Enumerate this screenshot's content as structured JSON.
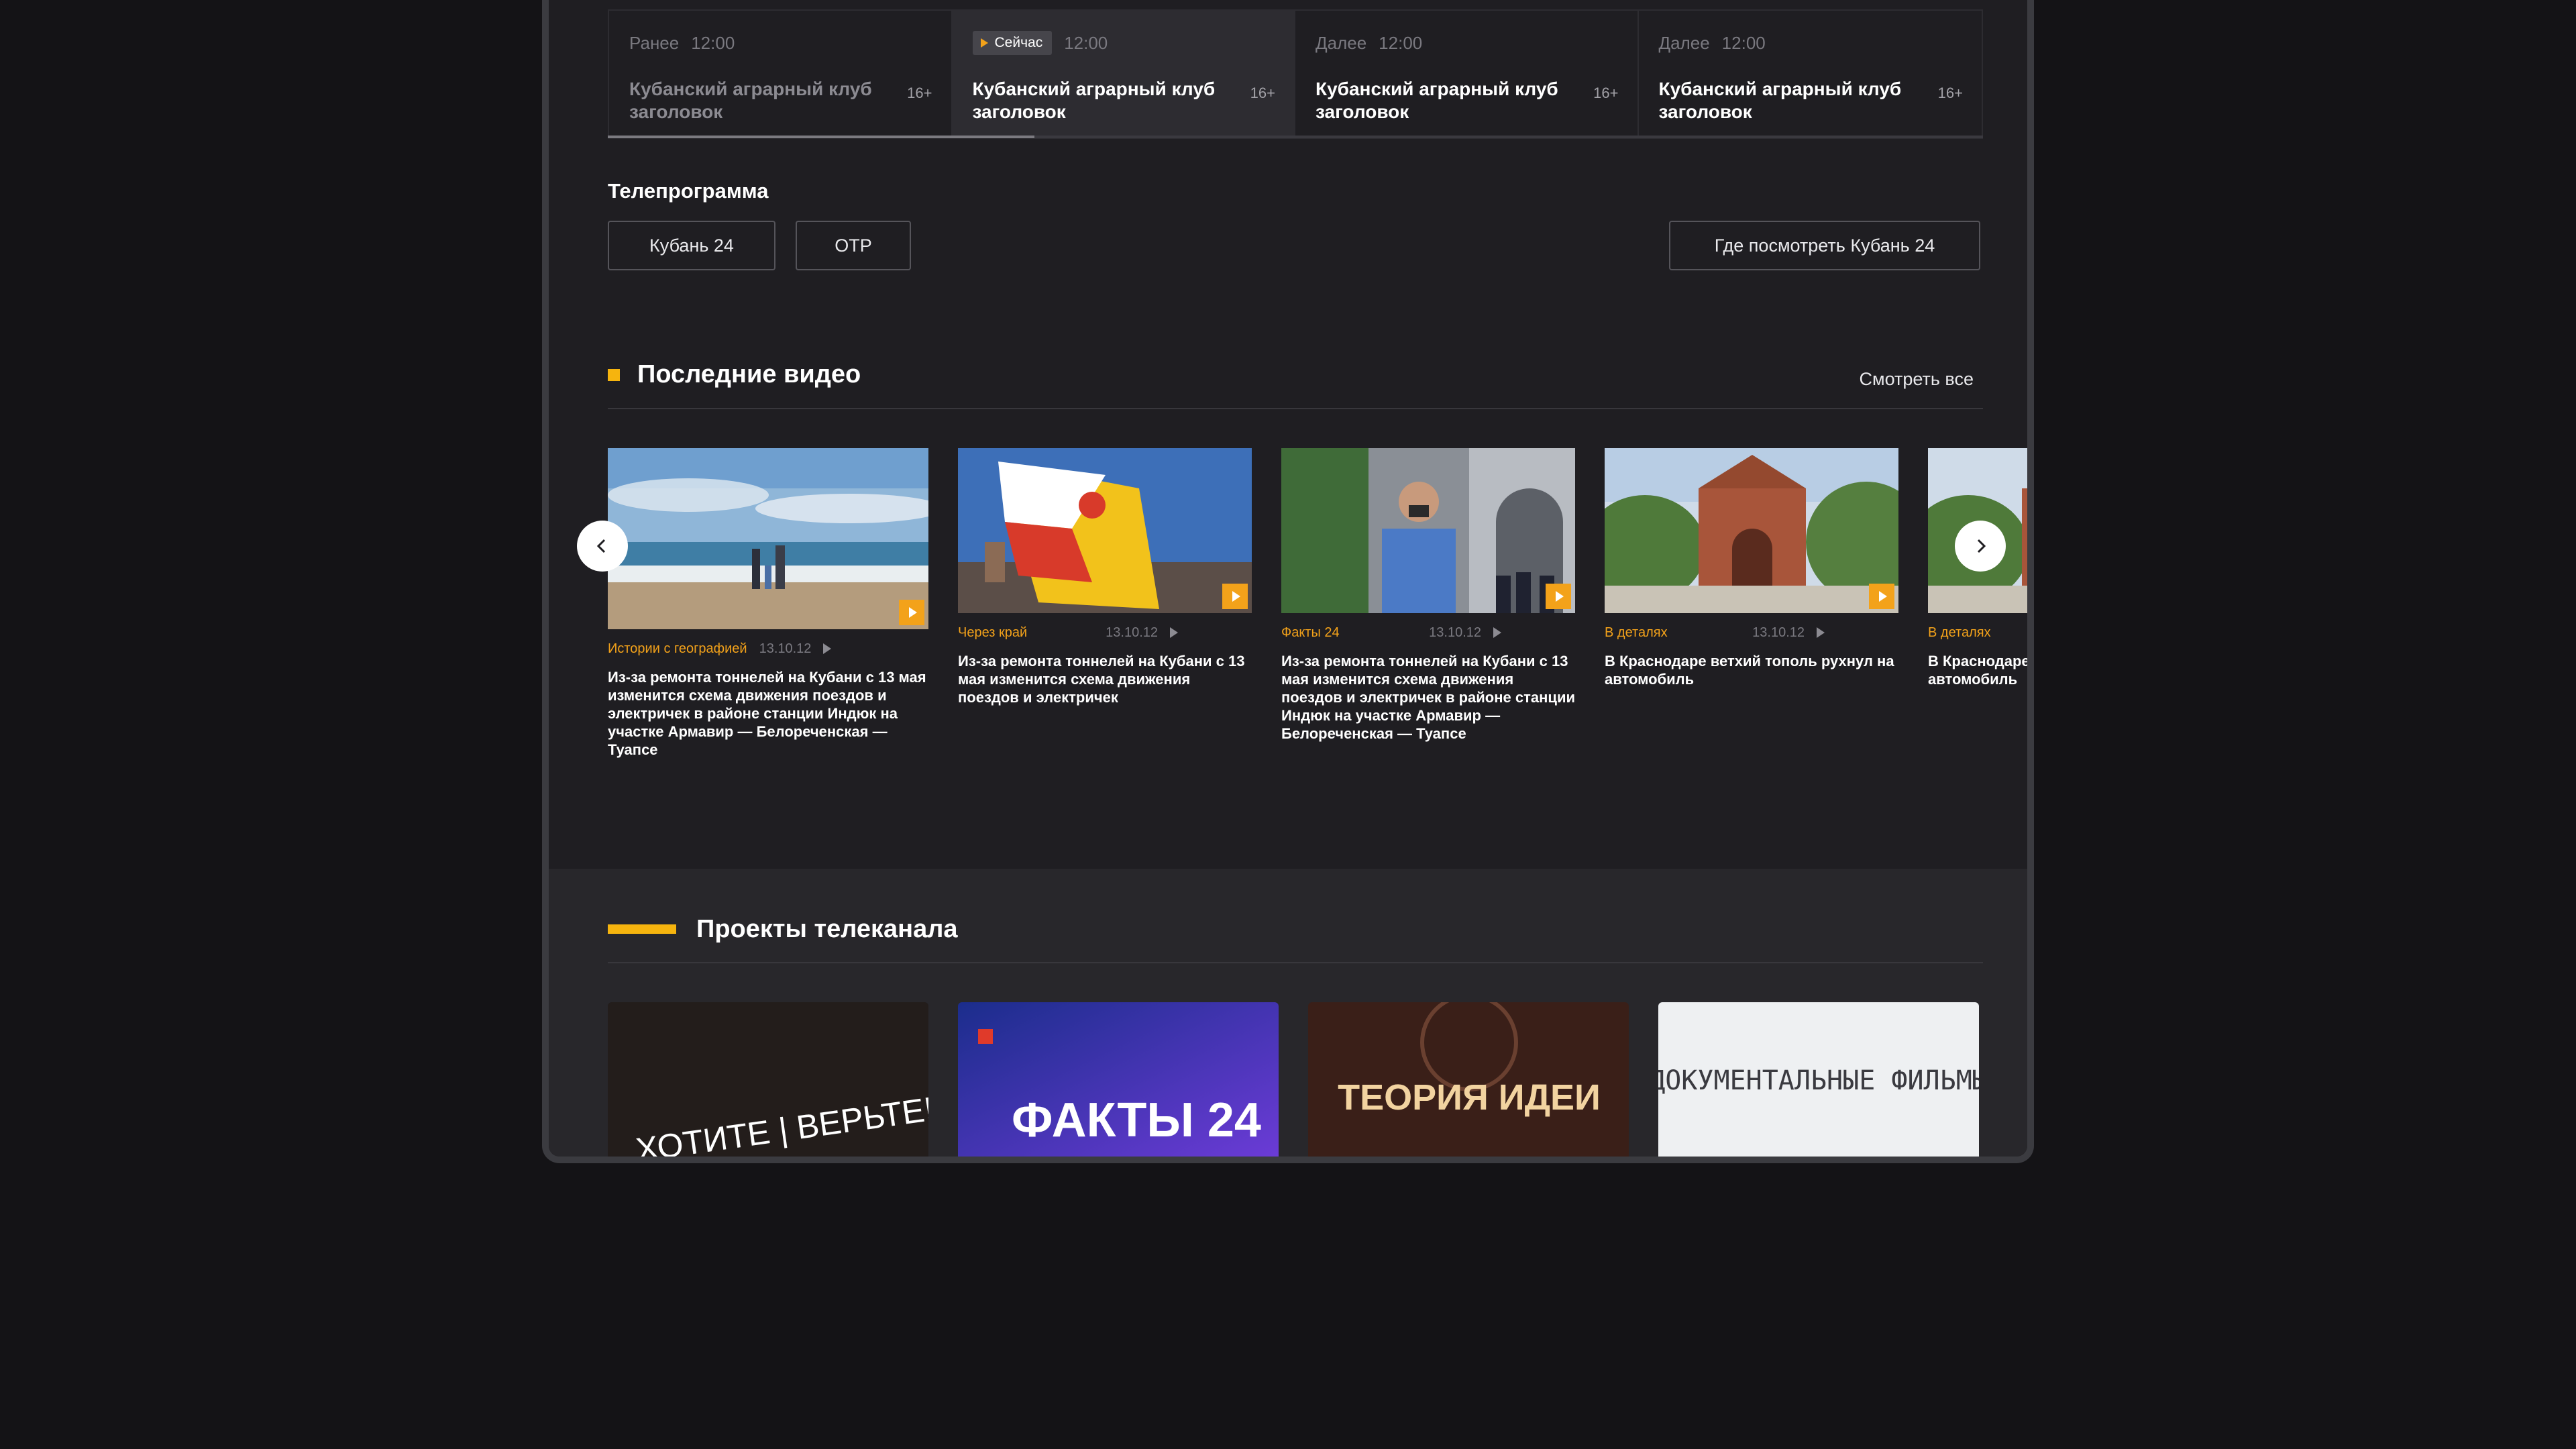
{
  "schedule": [
    {
      "label": "Ранее",
      "time": "12:00",
      "title": "Кубанский аграрный клуб заголовок",
      "age": "16+",
      "state": "past"
    },
    {
      "label": "Сейчас",
      "time": "12:00",
      "title": "Кубанский аграрный клуб заголовок",
      "age": "16+",
      "state": "current"
    },
    {
      "label": "Далее",
      "time": "12:00",
      "title": "Кубанский аграрный клуб заголовок",
      "age": "16+",
      "state": "next"
    },
    {
      "label": "Далее",
      "time": "12:00",
      "title": "Кубанский аграрный клуб заголовок",
      "age": "16+",
      "state": "next"
    }
  ],
  "schedule_progress": 0.31,
  "tv_program": {
    "title": "Телепрограмма",
    "channels": [
      "Кубань 24",
      "ОТР"
    ],
    "where_to_watch": "Где посмотреть Кубань 24"
  },
  "latest_videos": {
    "title": "Последние видео",
    "see_all": "Смотреть все",
    "items": [
      {
        "category": "Истории с географией",
        "date": "13.10.12",
        "title": "Из-за ремонта тоннелей на Кубани с 13 мая изменится схема движения поездов и электричек в районе станции Индюк на участке Армавир — Белореченская — Туапсе"
      },
      {
        "category": "Через край",
        "date": "13.10.12",
        "title": "Из-за ремонта тоннелей на Кубани с 13 мая изменится схема движения поездов и электричек"
      },
      {
        "category": "Факты 24",
        "date": "13.10.12",
        "title": "Из-за ремонта тоннелей на Кубани с 13 мая изменится схема движения поездов и электричек в районе станции Индюк на участке Армавир — Белореченская — Туапсе"
      },
      {
        "category": "В деталях",
        "date": "13.10.12",
        "title": "В Краснодаре ветхий тополь рухнул на автомобиль"
      },
      {
        "category": "В деталях",
        "date": "",
        "title": "В Краснодаре ветхий тополь рухнул на автомобиль"
      }
    ]
  },
  "projects": {
    "title": "Проекты телеканала",
    "items": [
      {
        "name": "ХОТИТЕ | ВЕРЬТЕ!"
      },
      {
        "name": "ФАКТЫ 24"
      },
      {
        "name": "ТЕОРИЯ ИДЕИ"
      },
      {
        "name": "ДОКУМЕНТАЛЬНЫЕ ФИЛЬМЫ"
      }
    ]
  },
  "colors": {
    "accent": "#f3a21a",
    "section_marker": "#f6b40e",
    "bg": "#1f1e22",
    "page_bg": "#141316"
  },
  "icons": {
    "prev": "chevron-left-icon",
    "next": "chevron-right-icon",
    "play": "play-icon"
  }
}
